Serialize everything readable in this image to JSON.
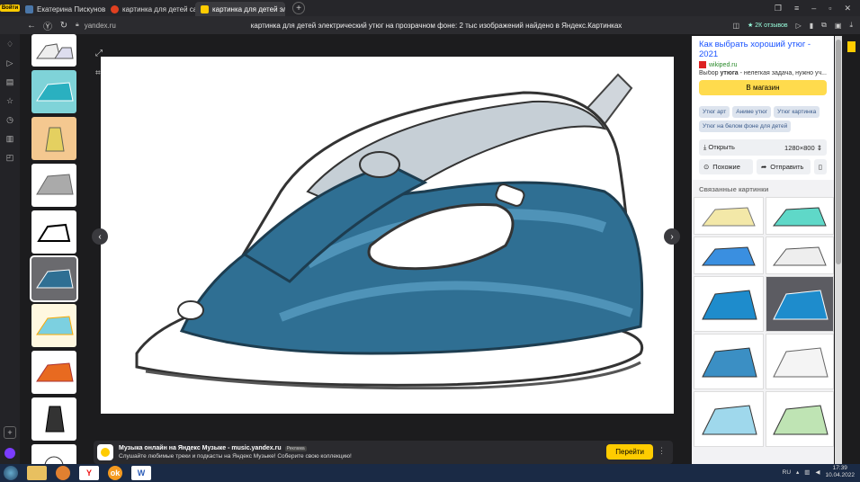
{
  "browser": {
    "tabs": [
      {
        "label": "Екатерина Пискунова",
        "color": "#4a76a8",
        "active": false
      },
      {
        "label": "картинка для детей сапог",
        "color": "#e04020",
        "active": false
      },
      {
        "label": "картинка для детей эле",
        "color": "#ffcc00",
        "active": true
      }
    ],
    "yandex_badge": "Войти",
    "url": "yandex.ru",
    "page_title": "картинка для детей электрический утюг на прозрачном фоне: 2 тыс изображений найдено в Яндекс.Картинках",
    "reviews_label": "★ 2К отзывов"
  },
  "viewer": {
    "ad": {
      "title": "Музыка онлайн на Яндекс Музыке - music.yandex.ru",
      "tag": "Реклама",
      "subtitle": "Слушайте любимые треки и подкасты на Яндекс Музыке! Соберите свою коллекцию!",
      "button": "Перейти"
    }
  },
  "panel": {
    "title": "Как выбрать хороший утюг - 2021",
    "source": "wikiped.ru",
    "description_prefix": "Выбор ",
    "description_bold": "утюга",
    "description_suffix": " - нелегкая задача, нужно уч...",
    "shop_button": "В магазин",
    "tags": [
      "Утюг арт",
      "Аниме утюг",
      "Утюг картинка",
      "Утюг на белом фоне для детей"
    ],
    "open_label": "Открыть",
    "size_label": "1280×800",
    "similar_label": "Похожие",
    "send_label": "Отправить",
    "related_heading": "Связанные картинки"
  },
  "taskbar": {
    "lang": "RU",
    "time": "17:39",
    "date": "10.04.2022"
  },
  "colors": {
    "accent_yellow": "#ffcc00",
    "iron_blue": "#2f6f93",
    "link_blue": "#1a53ff"
  }
}
